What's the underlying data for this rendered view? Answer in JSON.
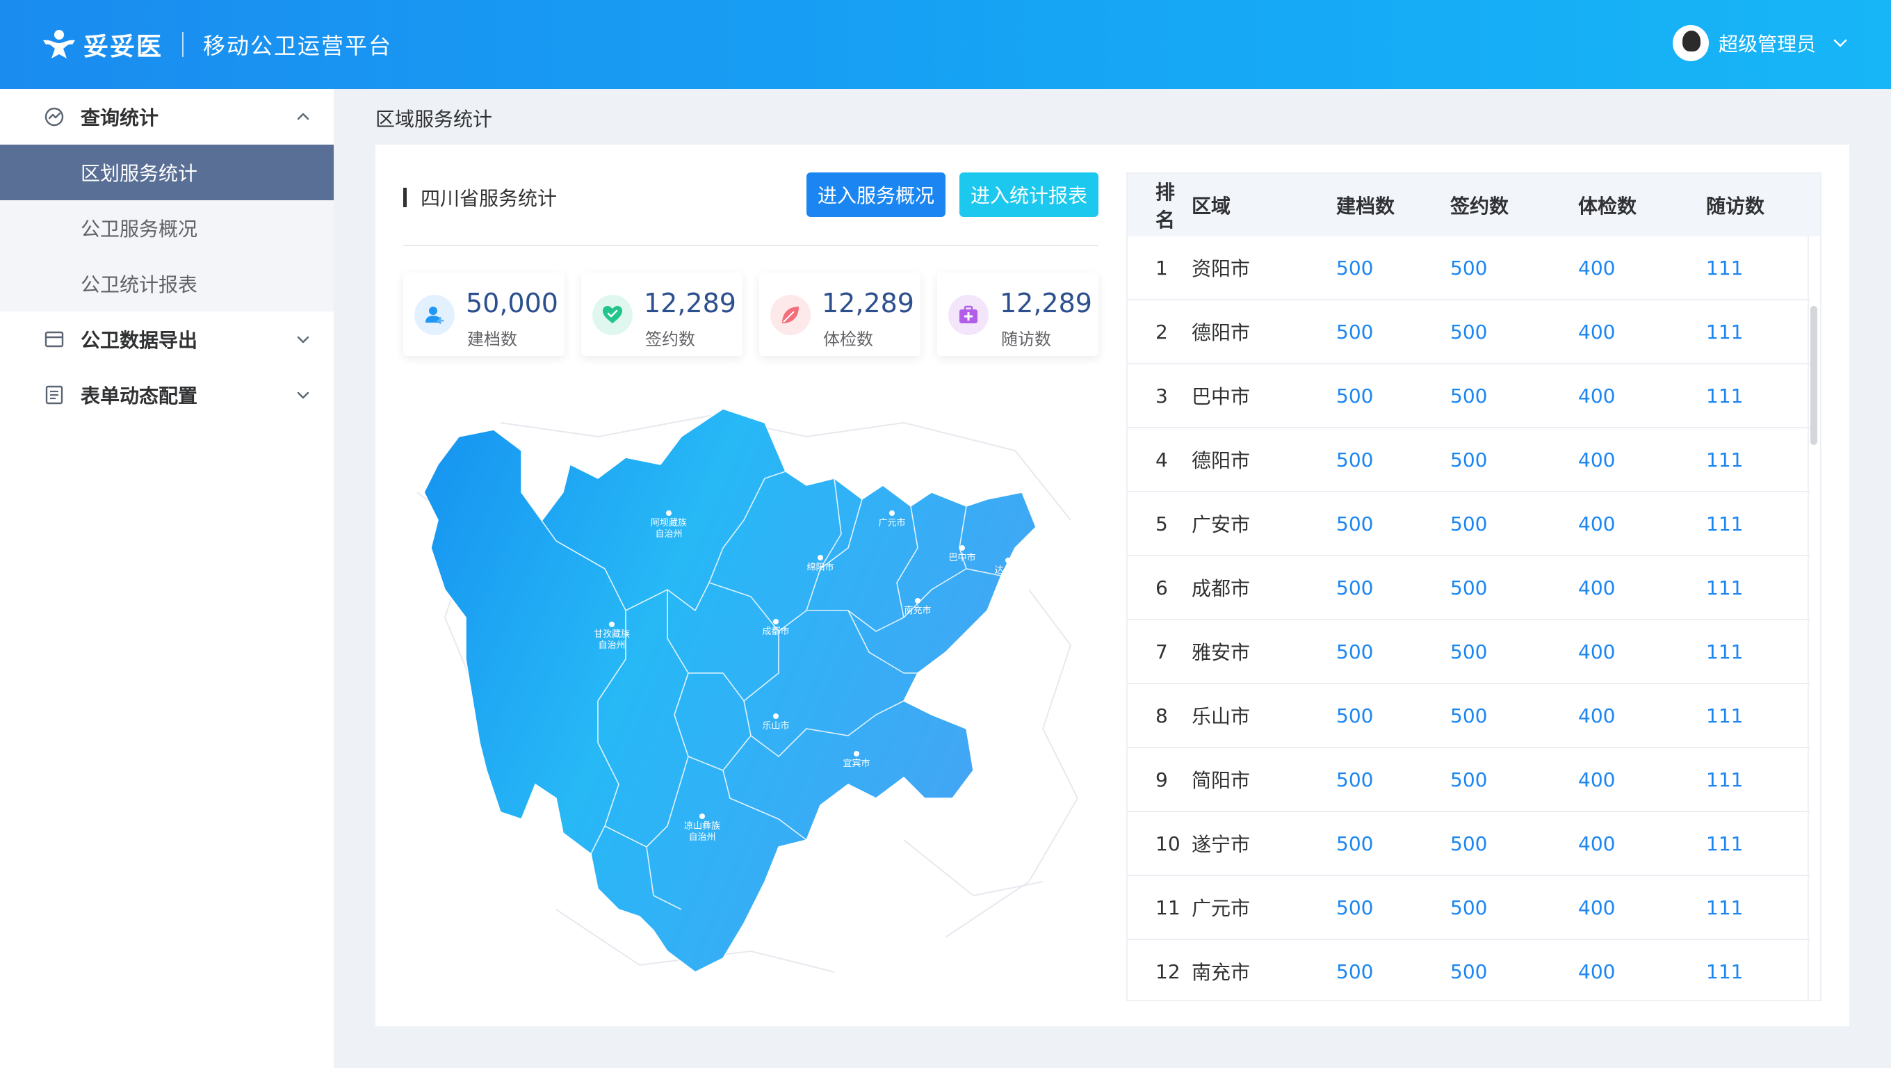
{
  "header": {
    "brand": "妥妥医",
    "platform": "移动公卫运营平台",
    "user_name": "超级管理员"
  },
  "sidebar": {
    "groups": [
      {
        "label": "查询统计",
        "expanded": true,
        "items": [
          {
            "label": "区划服务统计",
            "active": true
          },
          {
            "label": "公卫服务概况"
          },
          {
            "label": "公卫统计报表"
          }
        ]
      },
      {
        "label": "公卫数据导出",
        "expanded": false
      },
      {
        "label": "表单动态配置",
        "expanded": false
      }
    ]
  },
  "breadcrumb": "区域服务统计",
  "panel": {
    "title": "四川省服务统计",
    "btn_overview": "进入服务概况",
    "btn_report": "进入统计报表",
    "stats": [
      {
        "value": "50,000",
        "label": "建档数",
        "icon": "user-add-icon"
      },
      {
        "value": "12,289",
        "label": "签约数",
        "icon": "heart-check-icon"
      },
      {
        "value": "12,289",
        "label": "体检数",
        "icon": "leaf-icon"
      },
      {
        "value": "12,289",
        "label": "随访数",
        "icon": "medical-bag-icon"
      }
    ],
    "map_labels": [
      {
        "name": "阿坝藏族",
        "name2": "自治州"
      },
      {
        "name": "甘孜藏族",
        "name2": "自治州"
      },
      {
        "name": "凉山彝族",
        "name2": "自治州"
      },
      {
        "name": "绵阳市"
      },
      {
        "name": "广元市"
      },
      {
        "name": "巴中市"
      },
      {
        "name": "达州市"
      },
      {
        "name": "南充市"
      },
      {
        "name": "成都市"
      },
      {
        "name": "乐山市"
      },
      {
        "name": "宜宾市"
      }
    ]
  },
  "table": {
    "headers": [
      "排名",
      "区域",
      "建档数",
      "签约数",
      "体检数",
      "随访数"
    ],
    "rows": [
      [
        "1",
        "资阳市",
        "500",
        "500",
        "400",
        "111"
      ],
      [
        "2",
        "德阳市",
        "500",
        "500",
        "400",
        "111"
      ],
      [
        "3",
        "巴中市",
        "500",
        "500",
        "400",
        "111"
      ],
      [
        "4",
        "德阳市",
        "500",
        "500",
        "400",
        "111"
      ],
      [
        "5",
        "广安市",
        "500",
        "500",
        "400",
        "111"
      ],
      [
        "6",
        "成都市",
        "500",
        "500",
        "400",
        "111"
      ],
      [
        "7",
        "雅安市",
        "500",
        "500",
        "400",
        "111"
      ],
      [
        "8",
        "乐山市",
        "500",
        "500",
        "400",
        "111"
      ],
      [
        "9",
        "简阳市",
        "500",
        "500",
        "400",
        "111"
      ],
      [
        "10",
        "遂宁市",
        "500",
        "500",
        "400",
        "111"
      ],
      [
        "11",
        "广元市",
        "500",
        "500",
        "400",
        "111"
      ],
      [
        "12",
        "南充市",
        "500",
        "500",
        "400",
        "111"
      ]
    ]
  },
  "colors": {
    "header_start": "#1a8cf0",
    "header_end": "#17b6f7",
    "active_menu": "#5a6f95",
    "primary": "#1b86f2",
    "cyan": "#1cc8ee"
  }
}
